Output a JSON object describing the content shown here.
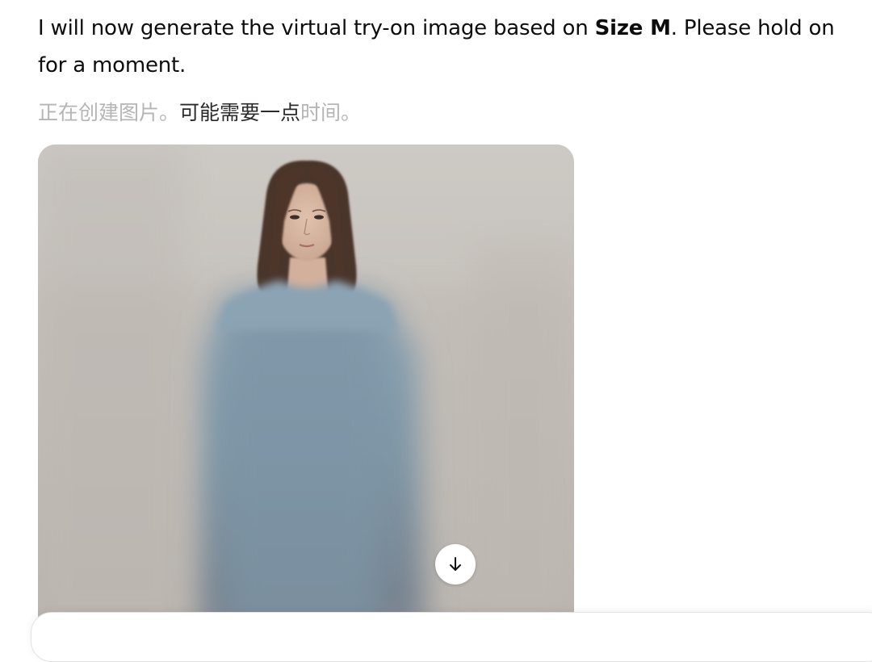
{
  "message": {
    "part1": "I will now generate the virtual try-on image based on ",
    "bold": "Size M",
    "part2": ". Please hold on for a moment."
  },
  "status": {
    "dim1": "正在创建图片。",
    "highlight": "可能需要一点",
    "dim2": "时间。"
  },
  "image": {
    "alt": "Generated virtual try-on image in progress"
  },
  "download": {
    "icon": "arrow-down-icon"
  },
  "colors": {
    "background": "#ffffff",
    "text": "#0d0d0d",
    "status_dim": "#b5b5b5",
    "image_bg": "#c9c5c0",
    "shirt": "#7f97a8"
  }
}
